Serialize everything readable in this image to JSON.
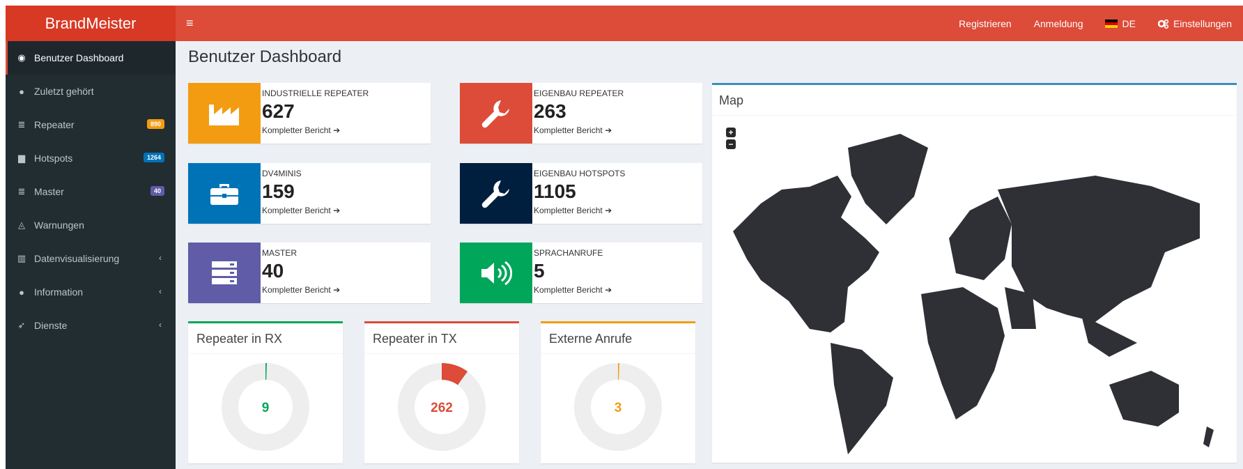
{
  "brand": "BrandMeister",
  "topnav": {
    "menu_glyph": "≡",
    "register": "Registrieren",
    "login": "Anmeldung",
    "language": "DE",
    "settings": "Einstellungen"
  },
  "sidebar": {
    "items": [
      {
        "label": "Benutzer Dashboard",
        "icon": "dashboard-icon",
        "glyph": "◉"
      },
      {
        "label": "Zuletzt gehört",
        "icon": "user-icon",
        "glyph": "●"
      },
      {
        "label": "Repeater",
        "icon": "server-icon",
        "glyph": "≣",
        "badge": "890",
        "badge_color": "#f39c12"
      },
      {
        "label": "Hotspots",
        "icon": "briefcase-icon",
        "glyph": "▆",
        "badge": "1264",
        "badge_color": "#0073b7"
      },
      {
        "label": "Master",
        "icon": "server-icon",
        "glyph": "≣",
        "badge": "40",
        "badge_color": "#605ca8"
      },
      {
        "label": "Warnungen",
        "icon": "bell-icon",
        "glyph": "◬"
      },
      {
        "label": "Datenvisualisierung",
        "icon": "bar-chart-icon",
        "glyph": "▥",
        "chevron": "‹"
      },
      {
        "label": "Information",
        "icon": "info-icon",
        "glyph": "●",
        "chevron": "‹"
      },
      {
        "label": "Dienste",
        "icon": "rocket-icon",
        "glyph": "➶",
        "chevron": "‹"
      }
    ]
  },
  "page_title": "Benutzer Dashboard",
  "info_boxes": [
    {
      "label": "INDUSTRIELLE REPEATER",
      "value": "627",
      "link": "Kompletter Bericht",
      "color": "#f39c12",
      "icon": "industry-icon"
    },
    {
      "label": "EIGENBAU REPEATER",
      "value": "263",
      "link": "Kompletter Bericht",
      "color": "#dd4b39",
      "icon": "wrench-icon"
    },
    {
      "label": "DV4MINIS",
      "value": "159",
      "link": "Kompletter Bericht",
      "color": "#0073b7",
      "icon": "briefcase-icon"
    },
    {
      "label": "EIGENBAU HOTSPOTS",
      "value": "1105",
      "link": "Kompletter Bericht",
      "color": "#001f3f",
      "icon": "wrench-icon"
    },
    {
      "label": "MASTER",
      "value": "40",
      "link": "Kompletter Bericht",
      "color": "#605ca8",
      "icon": "server-icon"
    },
    {
      "label": "SPRACHANRUFE",
      "value": "5",
      "link": "Kompletter Bericht",
      "color": "#00a65a",
      "icon": "volume-icon"
    }
  ],
  "donuts": [
    {
      "title": "Repeater in RX",
      "value": "9",
      "color": "#00a65a",
      "fraction": 0.005
    },
    {
      "title": "Repeater in TX",
      "value": "262",
      "color": "#dd4b39",
      "fraction": 0.1
    },
    {
      "title": "Externe Anrufe",
      "value": "3",
      "color": "#f39c12",
      "fraction": 0.002
    }
  ],
  "map": {
    "title": "Map",
    "zoom_in": "+",
    "zoom_out": "−"
  }
}
